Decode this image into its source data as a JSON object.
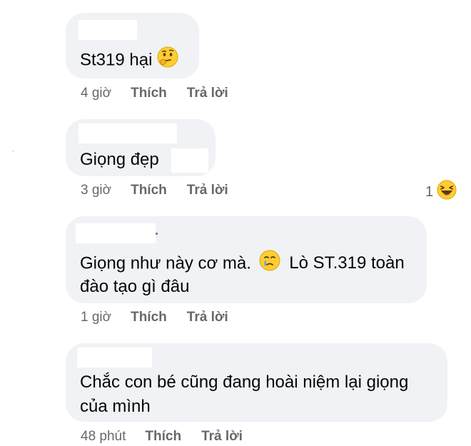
{
  "comments": [
    {
      "text": "St319 hại",
      "emoji": "thinking-face-icon",
      "time": "4 giờ",
      "like": "Thích",
      "reply": "Trả lời"
    },
    {
      "text": "Giọng đẹp",
      "time": "3 giờ",
      "like": "Thích",
      "reply": "Trả lời",
      "reaction_count": "1",
      "reaction_emoji": "laughing-face-icon"
    },
    {
      "text_line1": "Giọng như này cơ mà.",
      "emoji": "crying-face-icon",
      "text_after_emoji": "Lò ST.319 toàn",
      "text_line2": "đào tạo gì đâu",
      "time": "1 giờ",
      "like": "Thích",
      "reply": "Trả lời"
    },
    {
      "text_line1": "Chắc con bé cũng đang hoài niệm lại giọng",
      "text_line2": "của mình",
      "time": "48 phút",
      "like": "Thích",
      "reply": "Trả lời"
    }
  ],
  "colors": {
    "bubble": "#f0f2f5",
    "text": "#050505",
    "meta": "#65676b"
  }
}
